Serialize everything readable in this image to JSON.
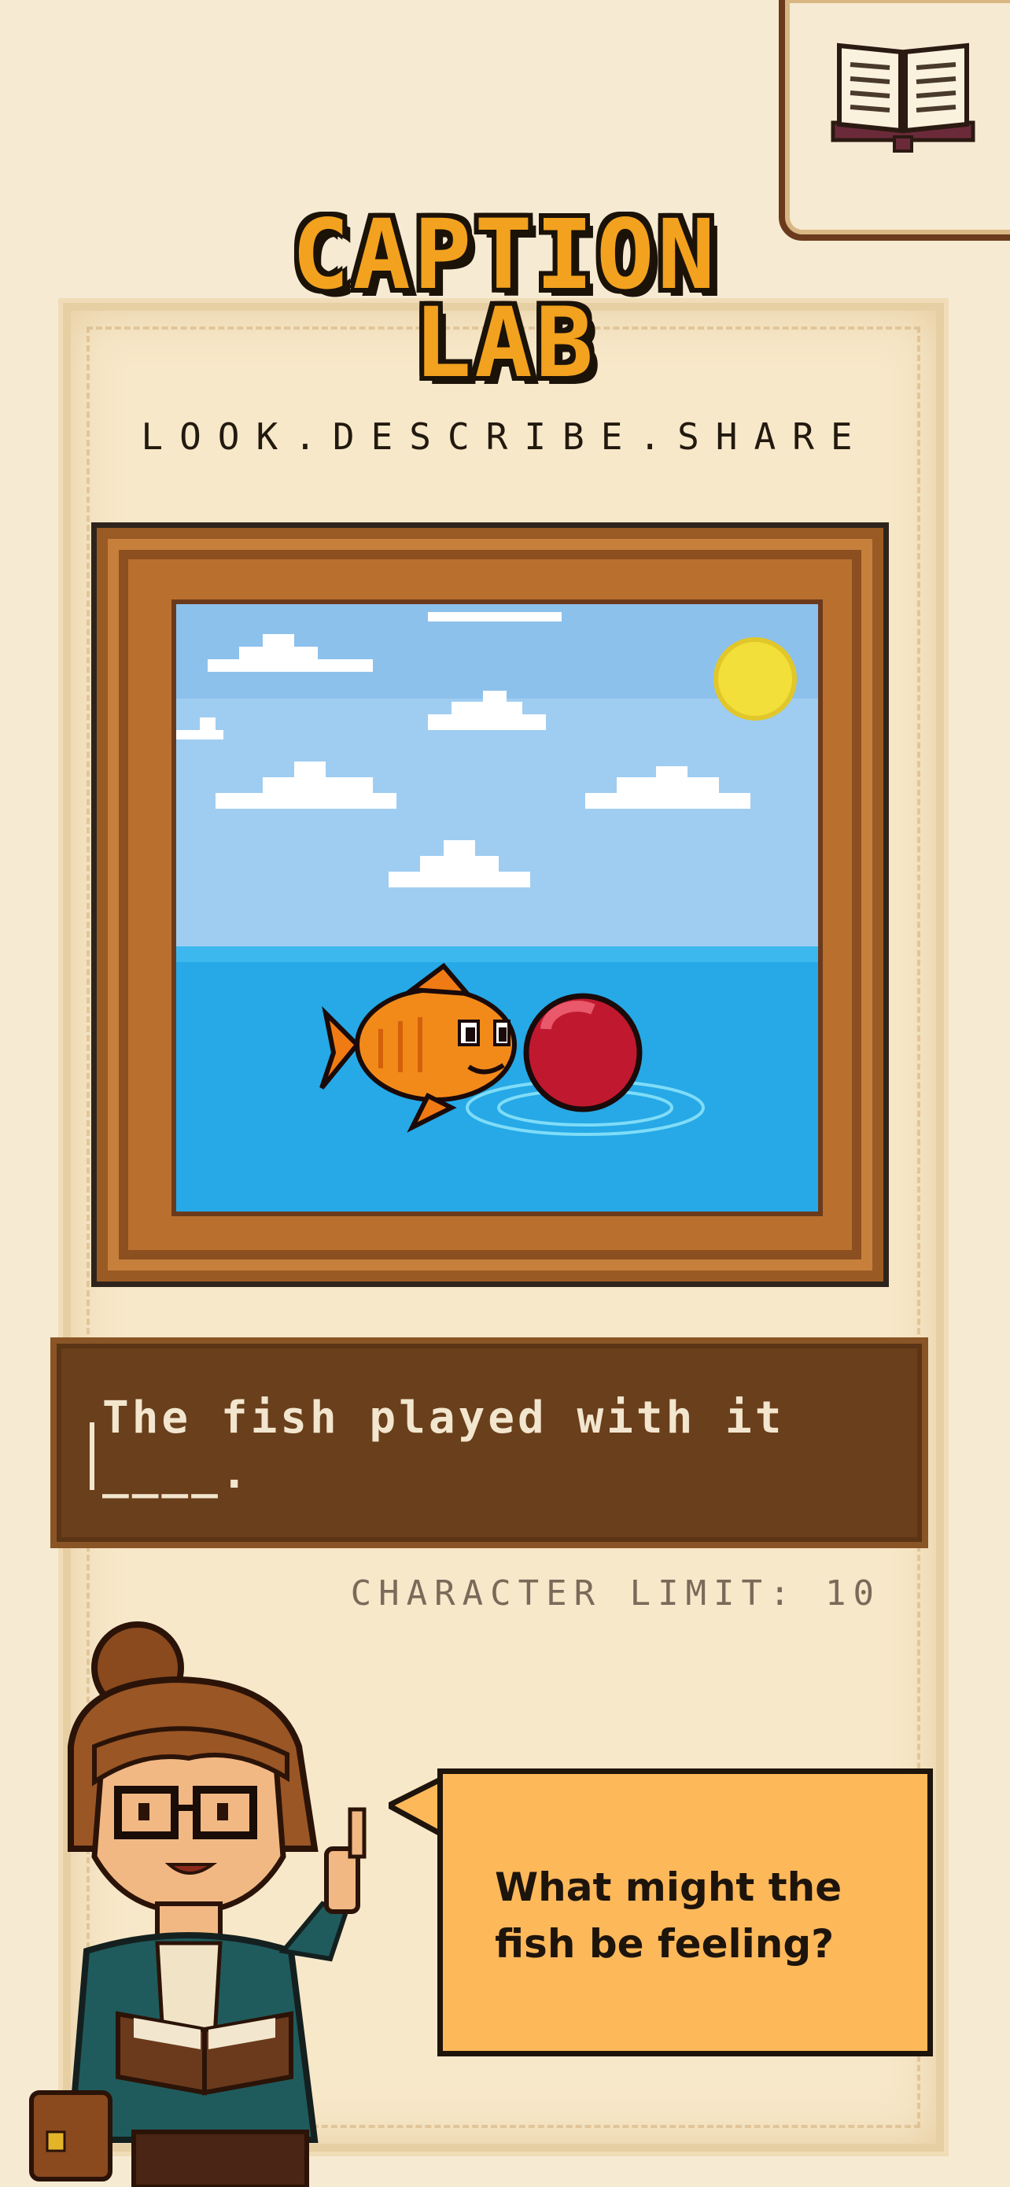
{
  "title": {
    "line1": "CAPTION",
    "line2": "LAB"
  },
  "tagline": "LOOK.DESCRIBE.SHARE",
  "book_button": {
    "icon": "open-book-icon"
  },
  "picture": {
    "scene": "fish-and-red-ball-icon"
  },
  "caption": {
    "text": "The fish played with it ____."
  },
  "char_limit": "CHARACTER LIMIT: 10",
  "helper": {
    "question": "What might the fish be feeling?"
  },
  "colors": {
    "title": "#f2a21e",
    "caption_bg": "#6a3f1b",
    "bubble": "#fdb85a",
    "frame": "#b9702e"
  }
}
